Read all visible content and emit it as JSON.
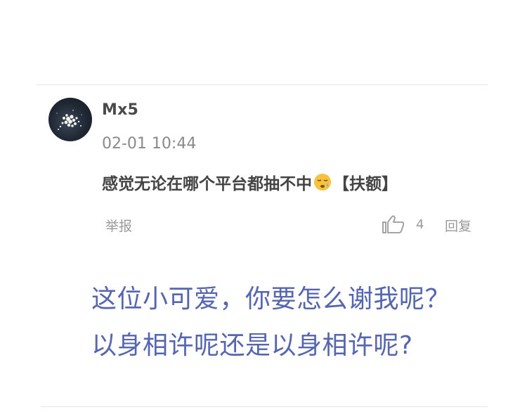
{
  "comment": {
    "username": "Mx5",
    "timestamp": "02-01 10:44",
    "text_before_emoji": "感觉无论在哪个平台都抽不中",
    "emoji": "sleepy-face-emoji",
    "text_after_emoji": "【扶额】",
    "report_label": "举报",
    "like_count": "4",
    "reply_label": "回复",
    "avatar": "avatar-flower-image"
  },
  "caption": {
    "line1": "这位小可爱，你要怎么谢我呢？",
    "line2": "以身相许呢还是以身相许呢?"
  },
  "colors": {
    "caption": "#5565b0",
    "username": "#4a4a4a",
    "meta": "#9a9a9a"
  }
}
